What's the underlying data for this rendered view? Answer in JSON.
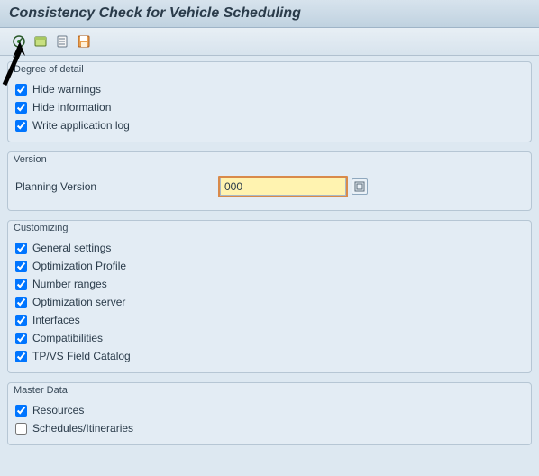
{
  "title": "Consistency Check for Vehicle Scheduling",
  "toolbar": {
    "execute": "Execute",
    "variant_get": "Get Variant",
    "variant_overview": "Variant Overview",
    "save": "Save"
  },
  "groups": {
    "degree_of_detail": {
      "title": "Degree of detail",
      "items": [
        {
          "label": "Hide warnings",
          "checked": true
        },
        {
          "label": "Hide information",
          "checked": true
        },
        {
          "label": "Write application log",
          "checked": true
        }
      ]
    },
    "version": {
      "title": "Version",
      "planning_version_label": "Planning Version",
      "planning_version_value": "000"
    },
    "customizing": {
      "title": "Customizing",
      "items": [
        {
          "label": "General settings",
          "checked": true
        },
        {
          "label": "Optimization Profile",
          "checked": true
        },
        {
          "label": "Number ranges",
          "checked": true
        },
        {
          "label": "Optimization server",
          "checked": true
        },
        {
          "label": "Interfaces",
          "checked": true
        },
        {
          "label": "Compatibilities",
          "checked": true
        },
        {
          "label": "TP/VS Field Catalog",
          "checked": true
        }
      ]
    },
    "master_data": {
      "title": "Master Data",
      "items": [
        {
          "label": "Resources",
          "checked": true
        },
        {
          "label": "Schedules/Itineraries",
          "checked": false
        }
      ]
    }
  }
}
